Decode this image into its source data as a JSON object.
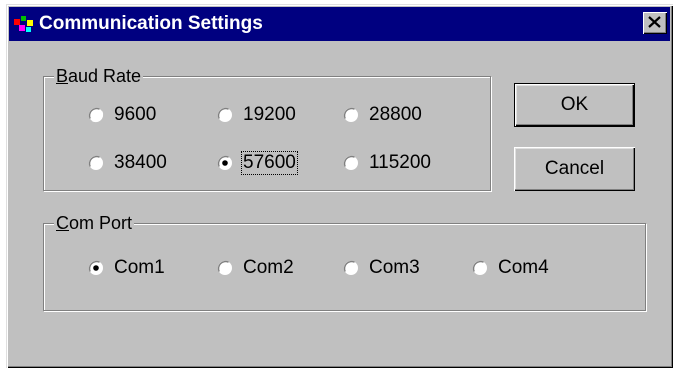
{
  "window": {
    "title": "Communication Settings",
    "close_glyph": "✕"
  },
  "baud_rate": {
    "label_mnemonic": "B",
    "label_rest": "aud Rate",
    "selected": "57600",
    "options": [
      "9600",
      "19200",
      "28800",
      "38400",
      "57600",
      "115200"
    ]
  },
  "com_port": {
    "label_mnemonic": "C",
    "label_rest": "om Port",
    "selected": "Com1",
    "options": [
      "Com1",
      "Com2",
      "Com3",
      "Com4"
    ]
  },
  "buttons": {
    "ok_label": "OK",
    "cancel_label": "Cancel"
  },
  "colors": {
    "titlebar": "#000080",
    "face": "#c0c0c0"
  },
  "icons": {
    "app": "app-icon",
    "close": "close-icon",
    "radio": "radio-button-icon"
  }
}
